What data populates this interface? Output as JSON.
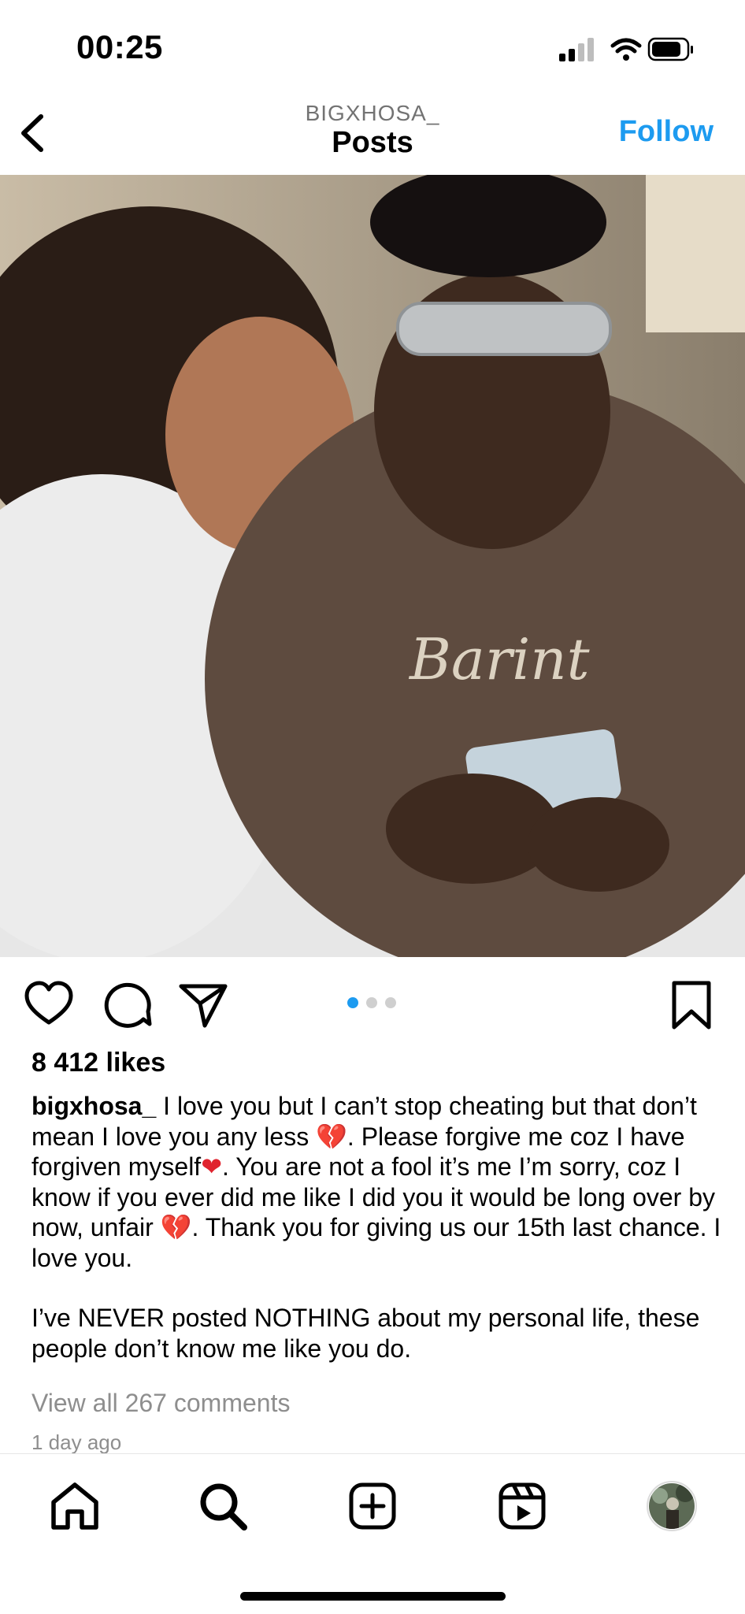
{
  "status_bar": {
    "time": "00:25"
  },
  "header": {
    "username": "BIGXHOSA_",
    "title": "Posts",
    "follow_label": "Follow"
  },
  "post": {
    "carousel": {
      "total": 3,
      "active": 1
    },
    "likes": "8 412 likes",
    "caption": {
      "username": "bigxhosa_",
      "segments": [
        " I love you but I can’t stop cheating but that don’t mean I love you any less ",
        "💔",
        ". Please forgive  me coz I have forgiven myself",
        "❤",
        ". You are not a fool it’s me I’m sorry, coz I know  if you ever did me like I did you it would be long over by now, unfair ",
        "💔",
        ". Thank you for giving us our 15th last chance. I love you."
      ],
      "paragraph2": "I’ve NEVER  posted NOTHING  about my personal life, these people don’t know me like you do."
    },
    "view_comments": "View all 267 comments",
    "timestamp": "1 day ago"
  },
  "colors": {
    "accent": "#1d9bf0",
    "heart": "#e0242f",
    "muted": "#8e8e8e"
  },
  "nav": {
    "items": [
      "home-icon",
      "search-icon",
      "create-icon",
      "reels-icon",
      "profile-avatar"
    ]
  }
}
